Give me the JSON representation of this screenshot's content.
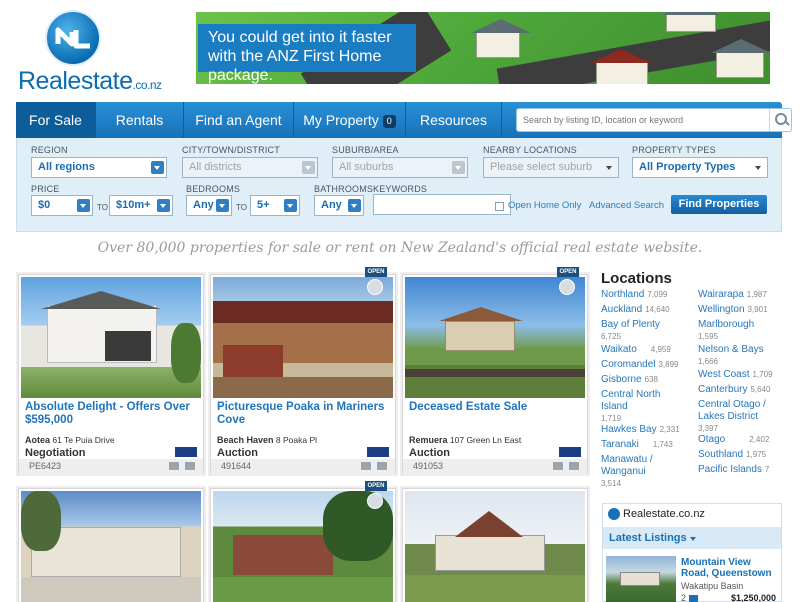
{
  "brand": {
    "name": "Realestate",
    "suffix": ".co.nz"
  },
  "banner": {
    "text": "You could get into it faster with the ANZ First Home package."
  },
  "nav": {
    "tabs": [
      {
        "label": "For Sale"
      },
      {
        "label": "Rentals"
      },
      {
        "label": "Find an Agent"
      },
      {
        "label": "My Property"
      },
      {
        "label": "Resources"
      }
    ],
    "my_property_count": "0",
    "search_placeholder": "Search by listing ID, location or keyword"
  },
  "filters": {
    "region": {
      "label": "REGION",
      "value": "All regions"
    },
    "district": {
      "label": "CITY/TOWN/DISTRICT",
      "value": "All districts"
    },
    "suburb": {
      "label": "SUBURB/AREA",
      "value": "All suburbs"
    },
    "nearby": {
      "label": "NEARBY LOCATIONS",
      "value": "Please select suburb"
    },
    "property_types": {
      "label": "PROPERTY TYPES",
      "value": "All Property Types"
    },
    "price": {
      "label": "PRICE",
      "min": "$0",
      "max": "$10m+"
    },
    "bedrooms": {
      "label": "BEDROOMS",
      "min": "Any",
      "max": "5+"
    },
    "bathrooms": {
      "label": "BATHROOMS",
      "value": "Any"
    },
    "keywords": {
      "label": "KEYWORDS",
      "value": ""
    },
    "to_label": "TO",
    "open_home": "Open Home Only",
    "advanced": "Advanced Search",
    "submit": "Find Properties"
  },
  "tagline": "Over 80,000 properties for sale or rent on New Zealand's official real estate website.",
  "listings": [
    {
      "title": "Absolute Delight - Offers Over $595,000",
      "suburb": "Aotea",
      "street": "61 Te Puia Drive",
      "price": "Negotiation",
      "id": "PE6423",
      "open": false
    },
    {
      "title": "Picturesque Poaka in Mariners Cove",
      "suburb": "Beach Haven",
      "street": "8 Poaka Pl",
      "price": "Auction",
      "id": "491644",
      "open": true
    },
    {
      "title": "Deceased Estate Sale",
      "suburb": "Remuera",
      "street": "107 Green Ln East",
      "price": "Auction",
      "id": "491053",
      "open": true
    }
  ],
  "open_flag": "OPEN",
  "locations": {
    "title": "Locations",
    "left": [
      {
        "name": "Northland",
        "count": "7,099"
      },
      {
        "name": "Auckland",
        "count": "14,640"
      },
      {
        "name": "Bay of Plenty",
        "count": "6,725"
      },
      {
        "name": "Waikato",
        "count": "4,959"
      },
      {
        "name": "Coromandel",
        "count": "3,899"
      },
      {
        "name": "Gisborne",
        "count": "638"
      },
      {
        "name": "Central North Island",
        "count": "1,719"
      },
      {
        "name": "Hawkes Bay",
        "count": "2,331"
      },
      {
        "name": "Taranaki",
        "count": "1,743"
      },
      {
        "name": "Manawatu / Wanganui",
        "count": "3,514"
      }
    ],
    "right": [
      {
        "name": "Wairarapa",
        "count": "1,987"
      },
      {
        "name": "Wellington",
        "count": "3,901"
      },
      {
        "name": "Marlborough",
        "count": "1,595"
      },
      {
        "name": "Nelson & Bays",
        "count": "1,666"
      },
      {
        "name": "West Coast",
        "count": "1,709"
      },
      {
        "name": "Canterbury",
        "count": "5,640"
      },
      {
        "name": "Central Otago / Lakes District",
        "count": "3,397"
      },
      {
        "name": "Otago",
        "count": "2,402"
      },
      {
        "name": "Southland",
        "count": "1,975"
      },
      {
        "name": "Pacific Islands",
        "count": "7"
      }
    ]
  },
  "sidebar_box": {
    "title": "Realestate.co.nz",
    "latest_label": "Latest Listings",
    "latest": {
      "title": "Mountain View Road, Queenstown",
      "suburb": "Wakatipu Basin",
      "beds": "2",
      "price": "$1,250,000"
    }
  }
}
